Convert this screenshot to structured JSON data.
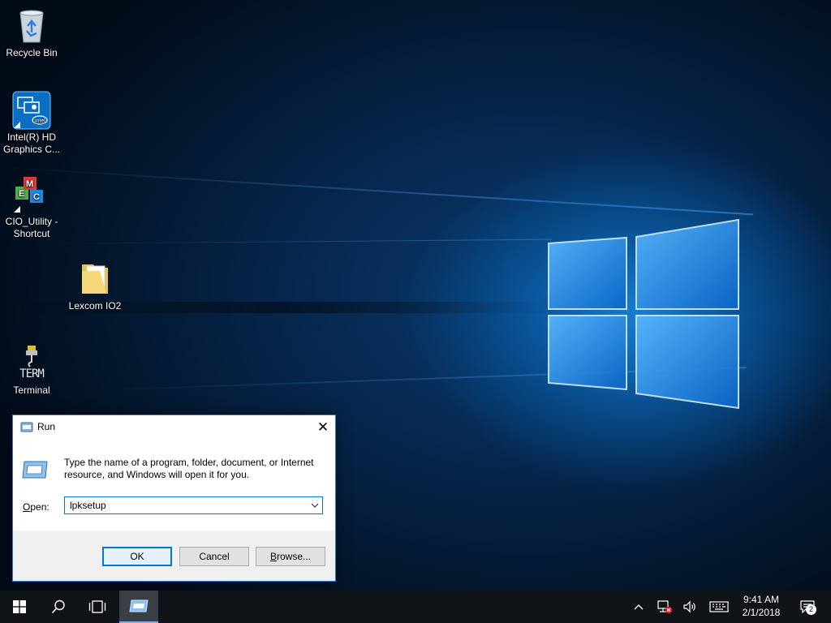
{
  "desktop": {
    "icons": [
      {
        "label": "Recycle Bin"
      },
      {
        "label": "Intel(R) HD Graphics C..."
      },
      {
        "label": "CIO_Utility - Shortcut"
      },
      {
        "label": "Lexcom IO2"
      },
      {
        "label": "Terminal"
      }
    ],
    "terminal_icon_text": "TERM"
  },
  "run_dialog": {
    "title": "Run",
    "close_glyph": "✕",
    "message": "Type the name of a program, folder, document, or Internet resource, and Windows will open it for you.",
    "open_label_accel": "O",
    "open_label_rest": "pen:",
    "open_value": "lpksetup",
    "buttons": {
      "ok": "OK",
      "cancel": "Cancel",
      "browse_accel": "B",
      "browse_rest": "rowse..."
    }
  },
  "taskbar": {
    "time": "9:41 AM",
    "date": "2/1/2018",
    "notification_count": "2"
  },
  "colors": {
    "accent": "#0078d7",
    "taskbar": "#101318",
    "dialog_bg": "#f0f0f0"
  }
}
